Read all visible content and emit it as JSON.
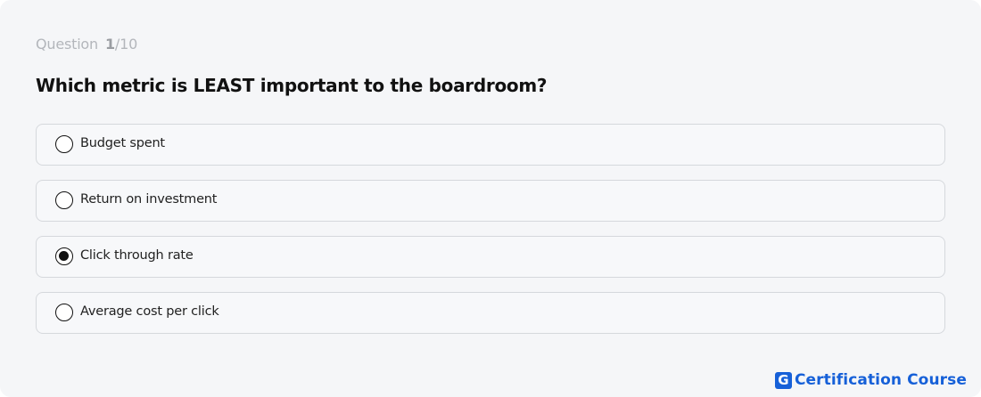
{
  "quiz": {
    "counter_label": "Question",
    "counter_current": "1",
    "counter_total": "/10",
    "question": "Which metric is LEAST important to the boardroom?",
    "options": [
      {
        "label": "Budget spent",
        "selected": false
      },
      {
        "label": "Return on investment",
        "selected": false
      },
      {
        "label": "Click through rate",
        "selected": true
      },
      {
        "label": "Average cost per click",
        "selected": false
      }
    ]
  },
  "brand": {
    "logo_letter": "G",
    "name": "Certification Course",
    "color": "#1660d8"
  }
}
